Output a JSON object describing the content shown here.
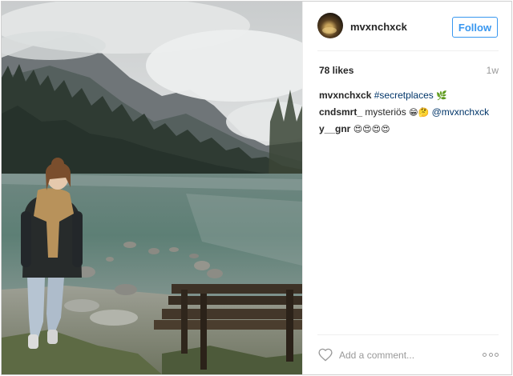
{
  "post": {
    "username": "mvxnchxck",
    "follow_label": "Follow",
    "likes": "78 likes",
    "time_ago": "1w",
    "comments": [
      {
        "user": "mvxnchxck",
        "text": "",
        "tag": "#secretplaces",
        "emoji": "🌿"
      },
      {
        "user": "cndsmrt_",
        "text": "mysteriös",
        "emoji": "😁🤔",
        "tag": "@mvxnchxck"
      },
      {
        "user": "y__gnr",
        "text": "",
        "emoji": "😍😍😍😍",
        "tag": ""
      }
    ],
    "add_comment_placeholder": "Add a comment...",
    "icons": {
      "like": "heart-icon",
      "more": "more-options-icon",
      "avatar": "avatar-image"
    },
    "colors": {
      "accent": "#3897f0",
      "link": "#003569",
      "muted": "#999999"
    }
  }
}
